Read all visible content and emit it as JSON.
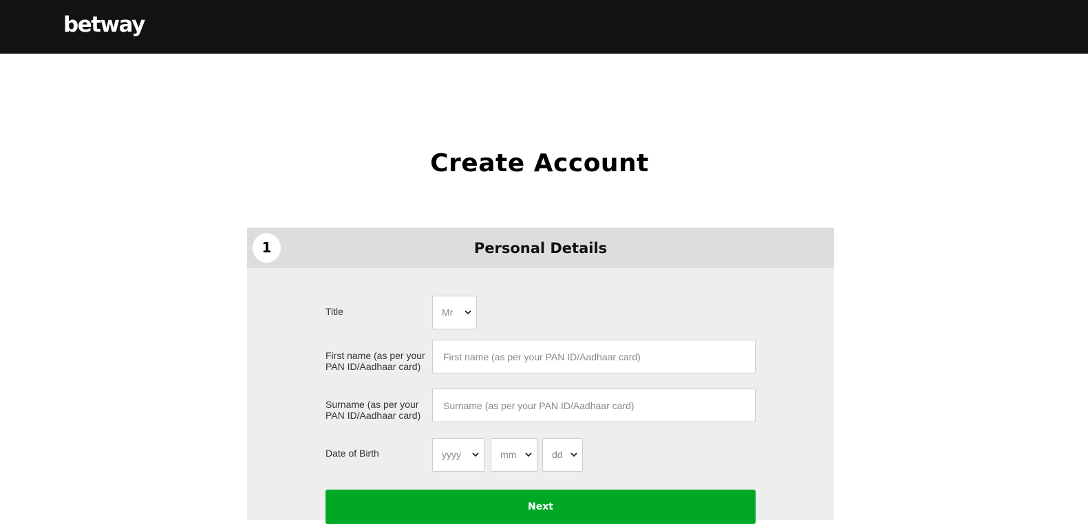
{
  "header": {
    "logo_text": "betway",
    "background_color": "#121212"
  },
  "page": {
    "title": "Create Account"
  },
  "step": {
    "number": "1",
    "title": "Personal Details"
  },
  "form": {
    "title_field": {
      "label": "Title",
      "selected": "Mr"
    },
    "first_name": {
      "label": "First name (as per your PAN ID/Aadhaar card)",
      "placeholder": "First name (as per your PAN ID/Aadhaar card)",
      "value": ""
    },
    "surname": {
      "label": "Surname (as per your PAN ID/Aadhaar card)",
      "placeholder": "Surname (as per your PAN ID/Aadhaar card)",
      "value": ""
    },
    "dob": {
      "label": "Date of Birth",
      "year": "yyyy",
      "month": "mm",
      "day": "dd"
    },
    "next_label": "Next"
  },
  "colors": {
    "accent_green": "#00a826",
    "panel_bg": "#eeeeee",
    "panel_header_bg": "#dddddd"
  },
  "icons": {
    "select_chevron": "chevron-down-icon"
  }
}
